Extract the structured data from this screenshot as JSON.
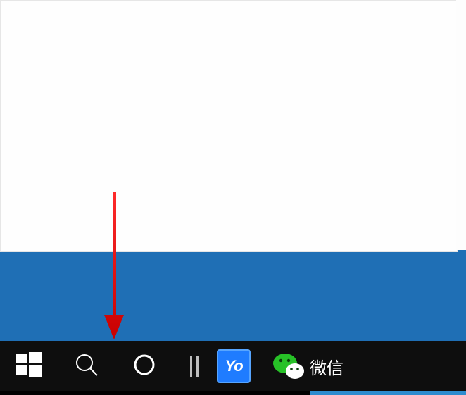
{
  "taskbar": {
    "start_name": "start-button",
    "search_name": "search-button",
    "cortana_name": "cortana-button",
    "taskview_name": "task-view-button",
    "apps": [
      {
        "id": "yo-app",
        "label": "Yo"
      },
      {
        "id": "wechat-app",
        "label": "微信"
      }
    ]
  },
  "annotation": {
    "arrow_target": "search-button",
    "arrow_color": "#ff0000"
  },
  "colors": {
    "desktop": "#1f6fb5",
    "taskbar": "#0e0e0e",
    "accent": "#1f7cff"
  }
}
